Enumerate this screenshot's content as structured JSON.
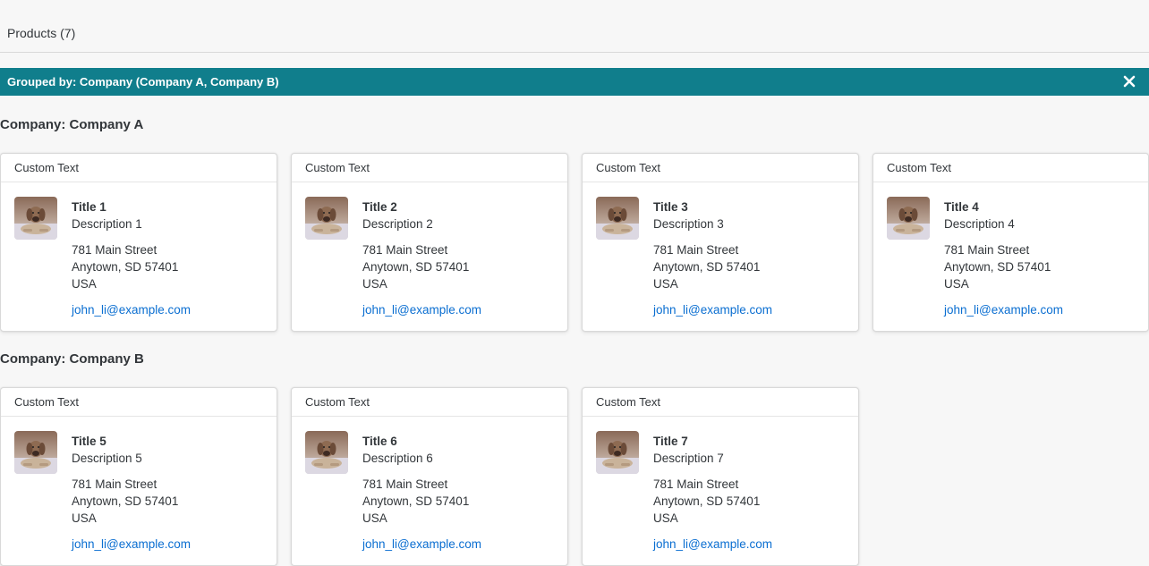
{
  "toolbar": {
    "title": "Products (7)"
  },
  "grouping": {
    "label": "Grouped by: Company (Company A, Company B)",
    "close_icon": "close-icon"
  },
  "groups": [
    {
      "header": "Company: Company A",
      "cards": [
        {
          "header": "Custom Text",
          "title": "Title 1",
          "description": "Description 1",
          "street": "781 Main Street",
          "city": "Anytown, SD 57401",
          "country": "USA",
          "email": "john_li@example.com"
        },
        {
          "header": "Custom Text",
          "title": "Title 2",
          "description": "Description 2",
          "street": "781 Main Street",
          "city": "Anytown, SD 57401",
          "country": "USA",
          "email": "john_li@example.com"
        },
        {
          "header": "Custom Text",
          "title": "Title 3",
          "description": "Description 3",
          "street": "781 Main Street",
          "city": "Anytown, SD 57401",
          "country": "USA",
          "email": "john_li@example.com"
        },
        {
          "header": "Custom Text",
          "title": "Title 4",
          "description": "Description 4",
          "street": "781 Main Street",
          "city": "Anytown, SD 57401",
          "country": "USA",
          "email": "john_li@example.com"
        }
      ]
    },
    {
      "header": "Company: Company B",
      "cards": [
        {
          "header": "Custom Text",
          "title": "Title 5",
          "description": "Description 5",
          "street": "781 Main Street",
          "city": "Anytown, SD 57401",
          "country": "USA",
          "email": "john_li@example.com"
        },
        {
          "header": "Custom Text",
          "title": "Title 6",
          "description": "Description 6",
          "street": "781 Main Street",
          "city": "Anytown, SD 57401",
          "country": "USA",
          "email": "john_li@example.com"
        },
        {
          "header": "Custom Text",
          "title": "Title 7",
          "description": "Description 7",
          "street": "781 Main Street",
          "city": "Anytown, SD 57401",
          "country": "USA",
          "email": "john_li@example.com"
        }
      ]
    }
  ],
  "colors": {
    "group_bar": "#107e8c",
    "link": "#0a6ed1"
  }
}
